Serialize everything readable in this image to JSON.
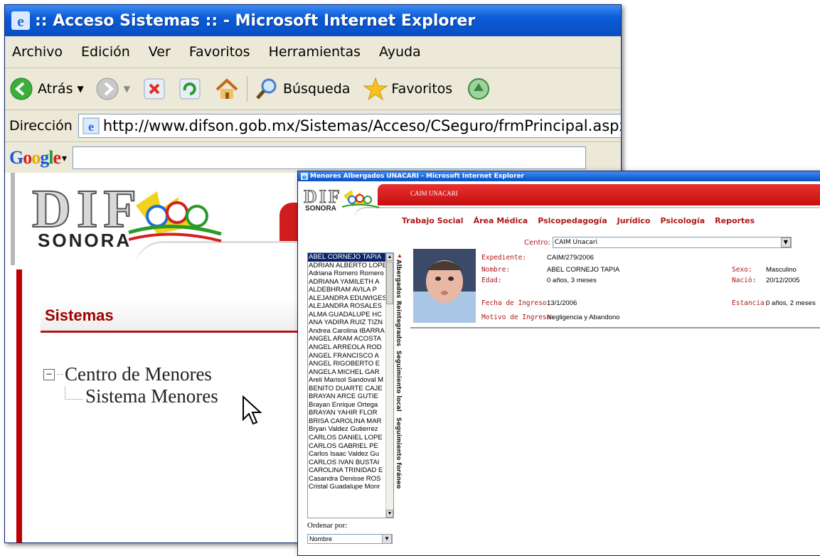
{
  "back_window": {
    "title": ":: Acceso Sistemas :: - Microsoft Internet Explorer",
    "menu": [
      "Archivo",
      "Edición",
      "Ver",
      "Favoritos",
      "Herramientas",
      "Ayuda"
    ],
    "toolbar": {
      "back_label": "Atrás",
      "search_label": "Búsqueda",
      "favorites_label": "Favoritos"
    },
    "address_label": "Dirección",
    "address_url": "http://www.difson.gob.mx/Sistemas/Acceso/CSeguro/frmPrincipal.aspx",
    "google_label": "Google",
    "logo": {
      "top": "DIF",
      "bottom": "SONORA"
    },
    "section_title": "Sistemas",
    "tree": {
      "root": "Centro de Menores",
      "child": "Sistema Menores"
    }
  },
  "front_window": {
    "title": "Menores Albergados UNACARI - Microsoft Internet Explorer",
    "header_label": "CAIM UNACARI",
    "logo": {
      "top": "DIF",
      "bottom": "SONORA"
    },
    "nav": [
      "Trabajo Social",
      "Área Médica",
      "Psicopedagogía",
      "Jurídico",
      "Psicología",
      "Reportes"
    ],
    "centro_label": "Centro:",
    "centro_value": "CAIM Unacari",
    "list_items": [
      "ABEL CORNEJO TAPIA",
      "ADRIAN ALBERTO LOPEZ",
      "Adriana Romero Romero",
      "ADRIANA YAMILETH A",
      "ALDEBHRAM AVILA P",
      "ALEJANDRA EDUWIGES",
      "ALEJANDRA ROSALES",
      "ALMA GUADALUPE HC",
      "ANA YADIRA RUIZ TIZN",
      "Andrea Carolina IBARRA",
      "ANGEL ARAM ACOSTA",
      "ANGEL ARREOLA ROD",
      "ANGEL FRANCISCO A",
      "ANGEL RIGOBERTO E",
      "ANGELA MICHEL GAR",
      "Areli Marisol Sandoval M",
      "BENITO DUARTE CAJE",
      "BRAYAN ARCE GUTIE",
      "Brayan Enrique Ortega",
      "BRAYAN YAHIR FLOR",
      "BRISA CAROLINA MAR",
      "Bryan Valdez Gutierrez",
      "CARLOS DANIEL LOPE",
      "CARLOS GABRIEL PE",
      "Carlos Isaac Valdez Gu",
      "CARLOS IVAN BUSTAI",
      "CAROLINA TRINIDAD E",
      "Casandra Denisse ROS",
      "Cristal Guadalupe Monr"
    ],
    "vertical_tabs": [
      "Albergados",
      "Reintegrados",
      "Seguimiento local",
      "Seguimiento foráneo"
    ],
    "ordenar_label": "Ordenar por:",
    "ordenar_value": "Nombre",
    "details": {
      "expediente_label": "Expediente:",
      "expediente": "CAIM/279/2006",
      "nombre_label": "Nombre:",
      "nombre": "ABEL CORNEJO TAPIA",
      "edad_label": "Edad:",
      "edad": "0 años, 3 meses",
      "sexo_label": "Sexo:",
      "sexo": "Masculino",
      "nacio_label": "Nació:",
      "nacio": "20/12/2005",
      "fecha_ingreso_label": "Fecha de Ingreso:",
      "fecha_ingreso": "13/1/2006",
      "estancia_label": "Estancia:",
      "estancia": "0 años, 2 meses",
      "motivo_label": "Motivo de Ingreso:",
      "motivo": "Negligencia y Abandono"
    }
  },
  "icons": [
    "ie-icon",
    "back-arrow-icon",
    "forward-arrow-icon",
    "stop-icon",
    "refresh-icon",
    "home-icon",
    "search-icon",
    "favorites-star-icon",
    "media-icon",
    "mouse-cursor-icon"
  ],
  "colors": {
    "xp_title_blue": "#0a4fc2",
    "dif_red": "#d01c1c",
    "label_red": "#b01818"
  }
}
